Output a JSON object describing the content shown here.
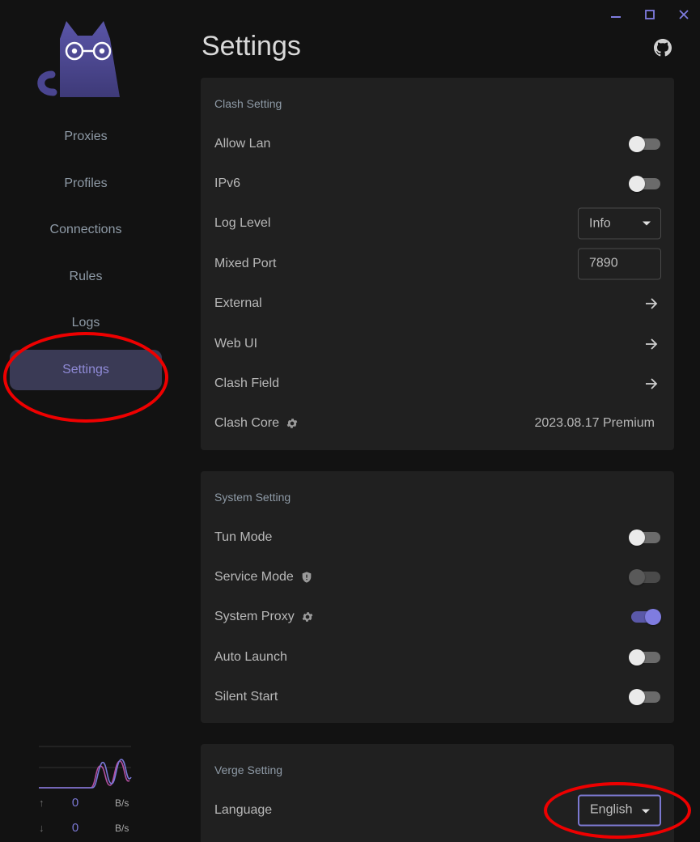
{
  "colors": {
    "background": "#121212",
    "panel": "#202020",
    "accent": "#7f7ce0",
    "annotation": "#e00000"
  },
  "window": {
    "controls": [
      "minimize-icon",
      "maximize-icon",
      "close-icon"
    ]
  },
  "sidebar": {
    "items": [
      {
        "label": "Proxies"
      },
      {
        "label": "Profiles"
      },
      {
        "label": "Connections"
      },
      {
        "label": "Rules"
      },
      {
        "label": "Logs"
      },
      {
        "label": "Settings",
        "active": true
      }
    ],
    "traffic": {
      "up": {
        "value": "0",
        "unit": "B/s"
      },
      "down": {
        "value": "0",
        "unit": "B/s"
      }
    }
  },
  "page": {
    "title": "Settings",
    "github_icon": "github-icon"
  },
  "clash_setting": {
    "title": "Clash Setting",
    "allow_lan": {
      "label": "Allow Lan",
      "on": false
    },
    "ipv6": {
      "label": "IPv6",
      "on": false
    },
    "log_level": {
      "label": "Log Level",
      "value": "Info"
    },
    "mixed_port": {
      "label": "Mixed Port",
      "value": "7890"
    },
    "external": {
      "label": "External"
    },
    "web_ui": {
      "label": "Web UI"
    },
    "clash_field": {
      "label": "Clash Field"
    },
    "clash_core": {
      "label": "Clash Core",
      "version": "2023.08.17 Premium"
    }
  },
  "system_setting": {
    "title": "System Setting",
    "tun_mode": {
      "label": "Tun Mode",
      "on": false
    },
    "service_mode": {
      "label": "Service Mode",
      "on": false
    },
    "system_proxy": {
      "label": "System Proxy",
      "on": true
    },
    "auto_launch": {
      "label": "Auto Launch",
      "on": false
    },
    "silent_start": {
      "label": "Silent Start",
      "on": false
    }
  },
  "verge_setting": {
    "title": "Verge Setting",
    "language": {
      "label": "Language",
      "value": "English"
    }
  }
}
